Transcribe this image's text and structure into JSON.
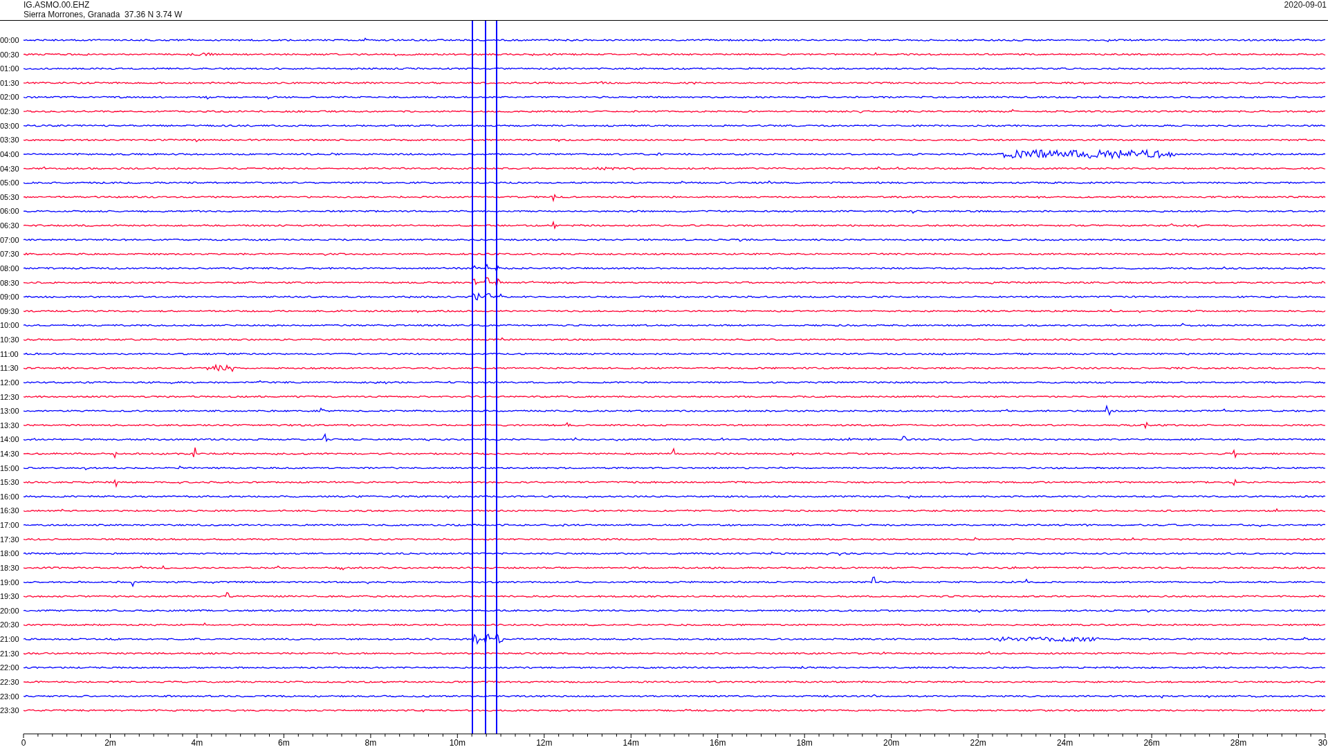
{
  "header": {
    "station": "IG.ASMO.00.EHZ",
    "location": "Sierra Morrones, Granada  37.36 N 3.74 W",
    "date": "2020-09-01"
  },
  "rows": [
    {
      "label": "00:00",
      "color": "#0000ff"
    },
    {
      "label": "00:30",
      "color": "#ff0033"
    },
    {
      "label": "01:00",
      "color": "#0000ff"
    },
    {
      "label": "01:30",
      "color": "#ff0033"
    },
    {
      "label": "02:00",
      "color": "#0000ff"
    },
    {
      "label": "02:30",
      "color": "#ff0033"
    },
    {
      "label": "03:00",
      "color": "#0000ff"
    },
    {
      "label": "03:30",
      "color": "#ff0033"
    },
    {
      "label": "04:00",
      "color": "#0000ff"
    },
    {
      "label": "04:30",
      "color": "#ff0033"
    },
    {
      "label": "05:00",
      "color": "#0000ff"
    },
    {
      "label": "05:30",
      "color": "#ff0033"
    },
    {
      "label": "06:00",
      "color": "#0000ff"
    },
    {
      "label": "06:30",
      "color": "#ff0033"
    },
    {
      "label": "07:00",
      "color": "#0000ff"
    },
    {
      "label": "07:30",
      "color": "#ff0033"
    },
    {
      "label": "08:00",
      "color": "#0000ff"
    },
    {
      "label": "08:30",
      "color": "#ff0033"
    },
    {
      "label": "09:00",
      "color": "#0000ff"
    },
    {
      "label": "09:30",
      "color": "#ff0033"
    },
    {
      "label": "10:00",
      "color": "#0000ff"
    },
    {
      "label": "10:30",
      "color": "#ff0033"
    },
    {
      "label": "11:00",
      "color": "#0000ff"
    },
    {
      "label": "11:30",
      "color": "#ff0033"
    },
    {
      "label": "12:00",
      "color": "#0000ff"
    },
    {
      "label": "12:30",
      "color": "#ff0033"
    },
    {
      "label": "13:00",
      "color": "#0000ff"
    },
    {
      "label": "13:30",
      "color": "#ff0033"
    },
    {
      "label": "14:00",
      "color": "#0000ff"
    },
    {
      "label": "14:30",
      "color": "#ff0033"
    },
    {
      "label": "15:00",
      "color": "#0000ff"
    },
    {
      "label": "15:30",
      "color": "#ff0033"
    },
    {
      "label": "16:00",
      "color": "#0000ff"
    },
    {
      "label": "16:30",
      "color": "#ff0033"
    },
    {
      "label": "17:00",
      "color": "#0000ff"
    },
    {
      "label": "17:30",
      "color": "#ff0033"
    },
    {
      "label": "18:00",
      "color": "#0000ff"
    },
    {
      "label": "18:30",
      "color": "#ff0033"
    },
    {
      "label": "19:00",
      "color": "#0000ff"
    },
    {
      "label": "19:30",
      "color": "#ff0033"
    },
    {
      "label": "20:00",
      "color": "#0000ff"
    },
    {
      "label": "20:30",
      "color": "#ff0033"
    },
    {
      "label": "21:00",
      "color": "#0000ff"
    },
    {
      "label": "21:30",
      "color": "#ff0033"
    },
    {
      "label": "22:00",
      "color": "#0000ff"
    },
    {
      "label": "22:30",
      "color": "#ff0033"
    },
    {
      "label": "23:00",
      "color": "#0000ff"
    },
    {
      "label": "23:30",
      "color": "#ff0033"
    }
  ],
  "time_axis": {
    "labels": [
      "0",
      "2m",
      "4m",
      "6m",
      "8m",
      "10m",
      "12m",
      "14m",
      "16m",
      "18m",
      "20m",
      "22m",
      "24m",
      "26m",
      "28m",
      "30"
    ]
  }
}
